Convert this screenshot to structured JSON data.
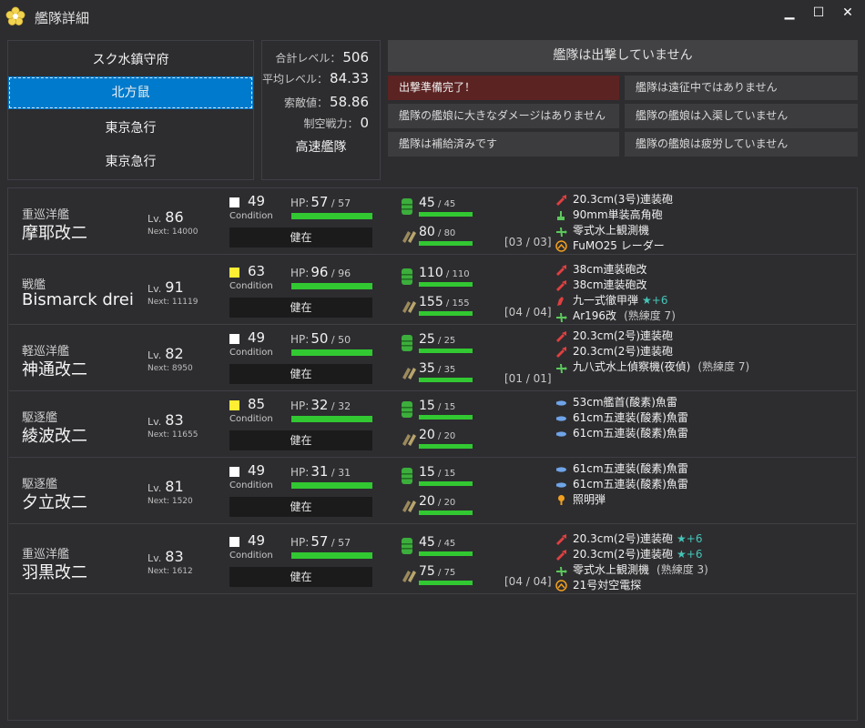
{
  "window": {
    "title": "艦隊詳細",
    "minimize": "▁",
    "maximize": "☐",
    "close": "✕"
  },
  "fleets": [
    "スク水鎮守府",
    "北方鼠",
    "東京急行",
    "東京急行"
  ],
  "stats": {
    "total_level_label": "合計レベル：",
    "total_level": "506",
    "avg_level_label": "平均レベル：",
    "avg_level": "84.33",
    "los_label": "索敵値：",
    "los": "58.86",
    "air_label": "制空戦力：",
    "air": "0",
    "speed": "高速艦隊"
  },
  "status": {
    "main": "艦隊は出撃していません",
    "items": [
      "出撃準備完了！",
      "艦隊は遠征中ではありません",
      "艦隊の艦娘に大きなダメージはありません",
      "艦隊の艦娘は入渠していません",
      "艦隊は補給済みです",
      "艦隊の艦娘は疲労していません"
    ]
  },
  "colors": {
    "accent": "#007acc",
    "alert": "#5c2323",
    "bar": "#32c832",
    "cond_normal": "#ffffff",
    "cond_sparkle": "#ffee33"
  },
  "ships": [
    {
      "type": "重巡洋艦",
      "name": "摩耶改二",
      "lv_label": "Lv.",
      "lv": "86",
      "next": "Next: 14000",
      "cond": "49",
      "cond_color": "#ffffff",
      "cond_label": "Condition",
      "hp_label": "HP:",
      "hp": "57",
      "hp_max": "57",
      "hp_ratio": 1,
      "health": "健在",
      "fuel": "45",
      "fuel_max": "45",
      "ammo": "80",
      "ammo_max": "80",
      "slots": "[03 / 03]",
      "equips": [
        {
          "icon": "main-gun-red-icon",
          "name": "20.3cm(3号)連装砲"
        },
        {
          "icon": "aa-gun-green-icon",
          "name": "90mm単装高角砲"
        },
        {
          "icon": "seaplane-green-icon",
          "name": "零式水上観測機"
        },
        {
          "icon": "radar-icon",
          "name": "FuMO25 レーダー"
        }
      ]
    },
    {
      "type": "戦艦",
      "name": "Bismarck drei",
      "lv_label": "Lv.",
      "lv": "91",
      "next": "Next: 11119",
      "cond": "63",
      "cond_color": "#ffee33",
      "cond_label": "Condition",
      "hp_label": "HP:",
      "hp": "96",
      "hp_max": "96",
      "hp_ratio": 1,
      "health": "健在",
      "fuel": "110",
      "fuel_max": "110",
      "ammo": "155",
      "ammo_max": "155",
      "slots": "[04 / 04]",
      "equips": [
        {
          "icon": "main-gun-red-icon",
          "name": "38cm連装砲改"
        },
        {
          "icon": "main-gun-red-icon",
          "name": "38cm連装砲改"
        },
        {
          "icon": "ap-shell-icon",
          "name": "九一式徹甲弾",
          "star": "★+6"
        },
        {
          "icon": "seaplane-green-icon",
          "name": "Ar196改",
          "prof": "(熟練度 7)"
        }
      ]
    },
    {
      "type": "軽巡洋艦",
      "name": "神通改二",
      "lv_label": "Lv.",
      "lv": "82",
      "next": "Next: 8950",
      "cond": "49",
      "cond_color": "#ffffff",
      "cond_label": "Condition",
      "hp_label": "HP:",
      "hp": "50",
      "hp_max": "50",
      "hp_ratio": 1,
      "health": "健在",
      "fuel": "25",
      "fuel_max": "25",
      "ammo": "35",
      "ammo_max": "35",
      "slots": "[01 / 01]",
      "equips": [
        {
          "icon": "main-gun-red-icon",
          "name": "20.3cm(2号)連装砲"
        },
        {
          "icon": "main-gun-red-icon",
          "name": "20.3cm(2号)連装砲"
        },
        {
          "icon": "seaplane-green-icon",
          "name": "九八式水上偵察機(夜偵)",
          "prof": "(熟練度 7)"
        }
      ]
    },
    {
      "type": "駆逐艦",
      "name": "綾波改二",
      "lv_label": "Lv.",
      "lv": "83",
      "next": "Next: 11655",
      "cond": "85",
      "cond_color": "#ffee33",
      "cond_label": "Condition",
      "hp_label": "HP:",
      "hp": "32",
      "hp_max": "32",
      "hp_ratio": 1,
      "health": "健在",
      "fuel": "15",
      "fuel_max": "15",
      "ammo": "20",
      "ammo_max": "20",
      "slots": "",
      "equips": [
        {
          "icon": "torpedo-blue-icon",
          "name": "53cm艦首(酸素)魚雷"
        },
        {
          "icon": "torpedo-blue-icon",
          "name": "61cm五連装(酸素)魚雷"
        },
        {
          "icon": "torpedo-blue-icon",
          "name": "61cm五連装(酸素)魚雷"
        }
      ]
    },
    {
      "type": "駆逐艦",
      "name": "夕立改二",
      "lv_label": "Lv.",
      "lv": "81",
      "next": "Next: 1520",
      "cond": "49",
      "cond_color": "#ffffff",
      "cond_label": "Condition",
      "hp_label": "HP:",
      "hp": "31",
      "hp_max": "31",
      "hp_ratio": 1,
      "health": "健在",
      "fuel": "15",
      "fuel_max": "15",
      "ammo": "20",
      "ammo_max": "20",
      "slots": "",
      "equips": [
        {
          "icon": "torpedo-blue-icon",
          "name": "61cm五連装(酸素)魚雷"
        },
        {
          "icon": "torpedo-blue-icon",
          "name": "61cm五連装(酸素)魚雷"
        },
        {
          "icon": "star-shell-icon",
          "name": "照明弾"
        }
      ]
    },
    {
      "type": "重巡洋艦",
      "name": "羽黒改二",
      "lv_label": "Lv.",
      "lv": "83",
      "next": "Next: 1612",
      "cond": "49",
      "cond_color": "#ffffff",
      "cond_label": "Condition",
      "hp_label": "HP:",
      "hp": "57",
      "hp_max": "57",
      "hp_ratio": 1,
      "health": "健在",
      "fuel": "45",
      "fuel_max": "45",
      "ammo": "75",
      "ammo_max": "75",
      "slots": "[04 / 04]",
      "equips": [
        {
          "icon": "main-gun-red-icon",
          "name": "20.3cm(2号)連装砲",
          "star": "★+6"
        },
        {
          "icon": "main-gun-red-icon",
          "name": "20.3cm(2号)連装砲",
          "star": "★+6"
        },
        {
          "icon": "seaplane-green-icon",
          "name": "零式水上観測機",
          "prof": "(熟練度 3)"
        },
        {
          "icon": "radar-icon",
          "name": "21号対空電探"
        }
      ]
    }
  ]
}
